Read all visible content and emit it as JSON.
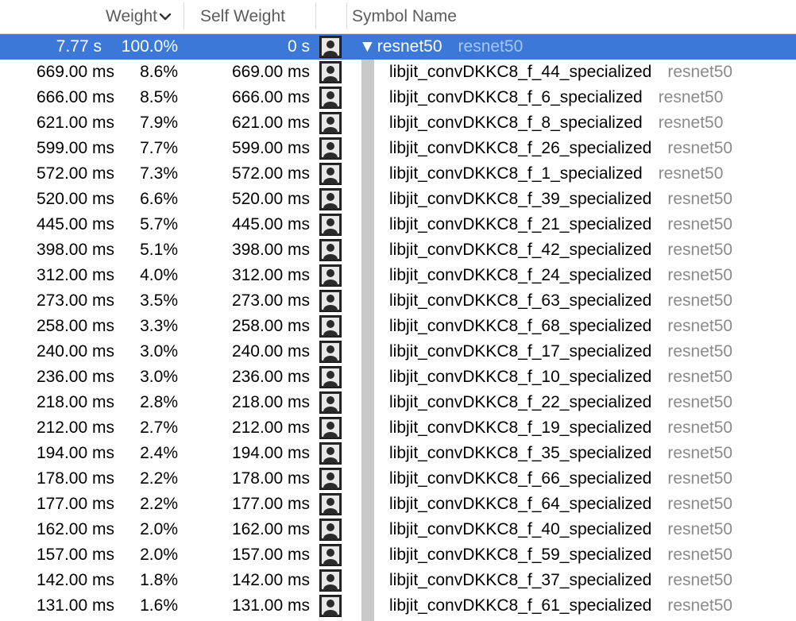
{
  "header": {
    "weight_label": "Weight",
    "self_weight_label": "Self Weight",
    "symbol_name_label": "Symbol Name"
  },
  "root": {
    "weight": "7.77 s",
    "percent": "100.0%",
    "self_weight": "0 s",
    "disclosure": "▼",
    "symbol": "resnet50",
    "library": "resnet50"
  },
  "rows": [
    {
      "weight": "669.00 ms",
      "percent": "8.6%",
      "self_weight": "669.00 ms",
      "symbol": "libjit_convDKKC8_f_44_specialized",
      "library": "resnet50"
    },
    {
      "weight": "666.00 ms",
      "percent": "8.5%",
      "self_weight": "666.00 ms",
      "symbol": "libjit_convDKKC8_f_6_specialized",
      "library": "resnet50"
    },
    {
      "weight": "621.00 ms",
      "percent": "7.9%",
      "self_weight": "621.00 ms",
      "symbol": "libjit_convDKKC8_f_8_specialized",
      "library": "resnet50"
    },
    {
      "weight": "599.00 ms",
      "percent": "7.7%",
      "self_weight": "599.00 ms",
      "symbol": "libjit_convDKKC8_f_26_specialized",
      "library": "resnet50"
    },
    {
      "weight": "572.00 ms",
      "percent": "7.3%",
      "self_weight": "572.00 ms",
      "symbol": "libjit_convDKKC8_f_1_specialized",
      "library": "resnet50"
    },
    {
      "weight": "520.00 ms",
      "percent": "6.6%",
      "self_weight": "520.00 ms",
      "symbol": "libjit_convDKKC8_f_39_specialized",
      "library": "resnet50"
    },
    {
      "weight": "445.00 ms",
      "percent": "5.7%",
      "self_weight": "445.00 ms",
      "symbol": "libjit_convDKKC8_f_21_specialized",
      "library": "resnet50"
    },
    {
      "weight": "398.00 ms",
      "percent": "5.1%",
      "self_weight": "398.00 ms",
      "symbol": "libjit_convDKKC8_f_42_specialized",
      "library": "resnet50"
    },
    {
      "weight": "312.00 ms",
      "percent": "4.0%",
      "self_weight": "312.00 ms",
      "symbol": "libjit_convDKKC8_f_24_specialized",
      "library": "resnet50"
    },
    {
      "weight": "273.00 ms",
      "percent": "3.5%",
      "self_weight": "273.00 ms",
      "symbol": "libjit_convDKKC8_f_63_specialized",
      "library": "resnet50"
    },
    {
      "weight": "258.00 ms",
      "percent": "3.3%",
      "self_weight": "258.00 ms",
      "symbol": "libjit_convDKKC8_f_68_specialized",
      "library": "resnet50"
    },
    {
      "weight": "240.00 ms",
      "percent": "3.0%",
      "self_weight": "240.00 ms",
      "symbol": "libjit_convDKKC8_f_17_specialized",
      "library": "resnet50"
    },
    {
      "weight": "236.00 ms",
      "percent": "3.0%",
      "self_weight": "236.00 ms",
      "symbol": "libjit_convDKKC8_f_10_specialized",
      "library": "resnet50"
    },
    {
      "weight": "218.00 ms",
      "percent": "2.8%",
      "self_weight": "218.00 ms",
      "symbol": "libjit_convDKKC8_f_22_specialized",
      "library": "resnet50"
    },
    {
      "weight": "212.00 ms",
      "percent": "2.7%",
      "self_weight": "212.00 ms",
      "symbol": "libjit_convDKKC8_f_19_specialized",
      "library": "resnet50"
    },
    {
      "weight": "194.00 ms",
      "percent": "2.4%",
      "self_weight": "194.00 ms",
      "symbol": "libjit_convDKKC8_f_35_specialized",
      "library": "resnet50"
    },
    {
      "weight": "178.00 ms",
      "percent": "2.2%",
      "self_weight": "178.00 ms",
      "symbol": "libjit_convDKKC8_f_66_specialized",
      "library": "resnet50"
    },
    {
      "weight": "177.00 ms",
      "percent": "2.2%",
      "self_weight": "177.00 ms",
      "symbol": "libjit_convDKKC8_f_64_specialized",
      "library": "resnet50"
    },
    {
      "weight": "162.00 ms",
      "percent": "2.0%",
      "self_weight": "162.00 ms",
      "symbol": "libjit_convDKKC8_f_40_specialized",
      "library": "resnet50"
    },
    {
      "weight": "157.00 ms",
      "percent": "2.0%",
      "self_weight": "157.00 ms",
      "symbol": "libjit_convDKKC8_f_59_specialized",
      "library": "resnet50"
    },
    {
      "weight": "142.00 ms",
      "percent": "1.8%",
      "self_weight": "142.00 ms",
      "symbol": "libjit_convDKKC8_f_37_specialized",
      "library": "resnet50"
    },
    {
      "weight": "131.00 ms",
      "percent": "1.6%",
      "self_weight": "131.00 ms",
      "symbol": "libjit_convDKKC8_f_61_specialized",
      "library": "resnet50"
    }
  ],
  "icons": {
    "sort": "chevron-down-icon",
    "row_icon": "user-silhouette-icon"
  },
  "colors": {
    "selection": "#3b78d8",
    "library_text": "#8a8a8a",
    "indent_bar": "#c8c8c8"
  }
}
